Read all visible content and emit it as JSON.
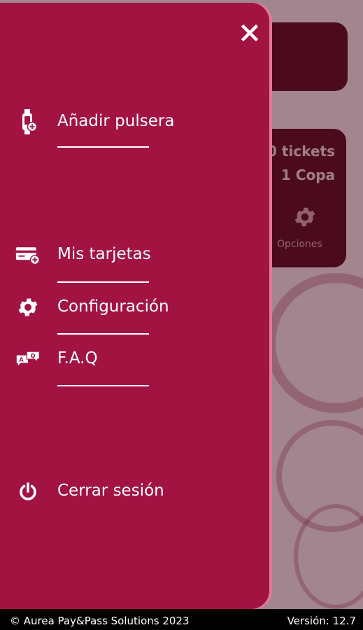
{
  "background_app": {
    "tickets_text": "0 tickets",
    "copa_text": "1 Copa",
    "options_label": "Opciones",
    "options_icon": "gear-icon"
  },
  "drawer": {
    "close_icon": "close-icon",
    "items": [
      {
        "label": "Añadir pulsera",
        "icon": "wristband-add-icon"
      },
      {
        "label": "Mis tarjetas",
        "icon": "card-add-icon"
      },
      {
        "label": "Configuración",
        "icon": "gear-icon"
      },
      {
        "label": "F.A.Q",
        "icon": "chat-bubbles-icon"
      },
      {
        "label": "Cerrar sesión",
        "icon": "power-icon"
      }
    ]
  },
  "footer": {
    "copyright": "© Aurea Pay&Pass Solutions 2023",
    "version": "Versión: 12.7"
  },
  "colors": {
    "drawer_bg": "#a31342",
    "card_bg": "#5a0b22",
    "text": "#ffffff"
  }
}
